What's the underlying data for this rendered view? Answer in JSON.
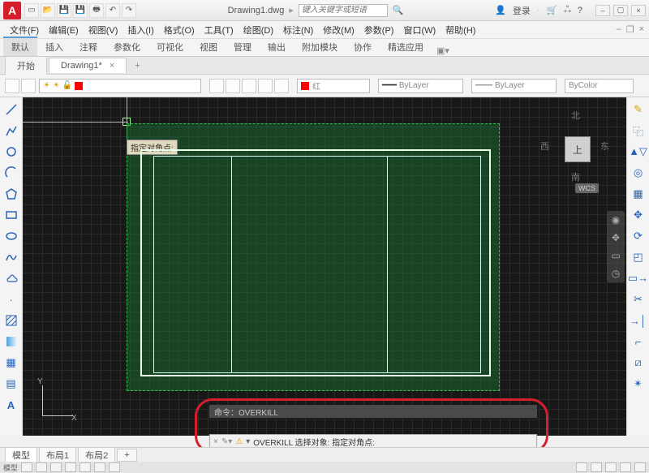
{
  "app": {
    "letter": "A",
    "filename": "Drawing1.dwg",
    "search_placeholder": "键入关键字或短语",
    "login": "登录"
  },
  "menus": [
    "文件(F)",
    "编辑(E)",
    "视图(V)",
    "插入(I)",
    "格式(O)",
    "工具(T)",
    "绘图(D)",
    "标注(N)",
    "修改(M)",
    "参数(P)",
    "窗口(W)",
    "帮助(H)"
  ],
  "ribbon_tabs": [
    "默认",
    "插入",
    "注释",
    "参数化",
    "可视化",
    "视图",
    "管理",
    "输出",
    "附加模块",
    "协作",
    "精选应用"
  ],
  "file_tabs": {
    "start": "开始",
    "active": "Drawing1*",
    "close": "×",
    "plus": "+"
  },
  "props": {
    "color_label": "红",
    "bylayer": "ByLayer",
    "lt_bylayer": "ByLayer",
    "bycolor": "ByColor"
  },
  "canvas": {
    "tooltip": "指定对角点:",
    "ucs_x": "X",
    "ucs_y": "Y",
    "wcs": "WCS",
    "cube": {
      "n": "北",
      "s": "南",
      "e": "东",
      "w": "西",
      "top": "上"
    }
  },
  "cmd": {
    "history": "命令：OVERKILL",
    "prefix": "OVERKILL 选择对象: 指定对角点:"
  },
  "bottom_tabs": {
    "model": "模型",
    "l1": "布局1",
    "l2": "布局2",
    "plus": "+"
  },
  "status": {
    "model": "模型",
    "grid": "▦"
  }
}
